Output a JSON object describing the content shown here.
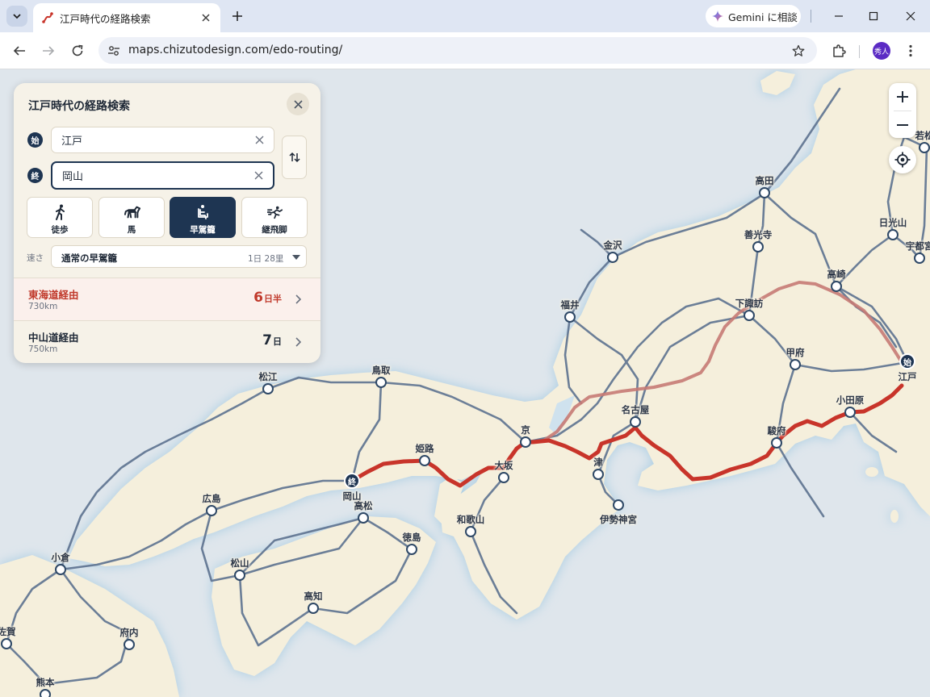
{
  "browser": {
    "tab_title": "江戸時代の経路検索",
    "gemini_label": "Gemini に相談",
    "url": "maps.chizutodesign.com/edo-routing/",
    "profile_initials": "秀人"
  },
  "panel": {
    "title": "江戸時代の経路検索",
    "origin_badge": "始",
    "origin_value": "江戸",
    "destination_badge": "終",
    "destination_value": "岡山",
    "modes": [
      {
        "label": "徒歩",
        "icon": "walk-icon",
        "selected": false
      },
      {
        "label": "馬",
        "icon": "horse-icon",
        "selected": false
      },
      {
        "label": "早駕籠",
        "icon": "palanquin-icon",
        "selected": true
      },
      {
        "label": "継飛脚",
        "icon": "courier-runner-icon",
        "selected": false
      }
    ],
    "speed_label": "速さ",
    "speed_value": "通常の早駕籠",
    "speed_rate": "1日 28里",
    "routes": [
      {
        "name": "東海道経由",
        "distance": "730km",
        "time_num": "6",
        "time_unit": "日半",
        "selected": true
      },
      {
        "name": "中山道経由",
        "distance": "750km",
        "time_num": "7",
        "time_unit": "日",
        "selected": false
      }
    ]
  },
  "map": {
    "route_start_badge": "始",
    "route_end_badge": "終",
    "cities": [
      "若松",
      "高田",
      "日光山",
      "宇都宮",
      "善光寺",
      "金沢",
      "高崎",
      "下諏訪",
      "福井",
      "甲府",
      "江戸",
      "松江",
      "鳥取",
      "京",
      "名古屋",
      "小田原",
      "姫路",
      "駿府",
      "大坂",
      "津",
      "岡山",
      "広島",
      "高松",
      "和歌山",
      "伊勢神宮",
      "徳島",
      "小倉",
      "松山",
      "高知",
      "佐賀",
      "府内",
      "熊本"
    ],
    "colors": {
      "land": "#f5efdc",
      "sea": "#dfe6ec",
      "road": "#5d7290",
      "active_route": "#c8342a",
      "alternate_route": "#c77a74"
    }
  }
}
